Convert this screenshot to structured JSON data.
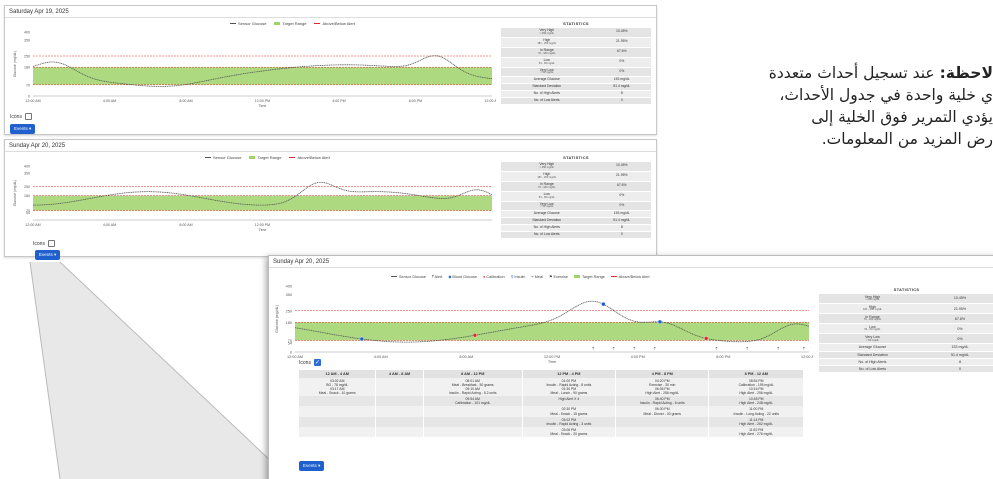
{
  "callout": {
    "lines": [
      "لاحظة: عند تسجيل أحداث متعددة",
      "ي خلية واحدة في جدول الأحداث،",
      "يؤدي التمرير فوق الخلية إلى",
      "رض المزيد من المعلومات."
    ],
    "bold_prefix": "لاحظة:"
  },
  "colors": {
    "target_band": "#9fd36a",
    "alert_line": "#e0282d",
    "glucose_line": "#555555",
    "button": "#1f5fce"
  },
  "panels": [
    {
      "date": "Saturday Apr 19, 2025",
      "legend": {
        "sensor": "Sensor Glucose",
        "target": "Target Range",
        "alert": "Above/Below Alert",
        "alert_sub": "CGM User Settings"
      },
      "y_axis_label": "Glucose (mg/dL)",
      "y_ticks": [
        "400",
        "350",
        "250",
        "180",
        "70",
        "0"
      ],
      "x_ticks": [
        "12:00 AM",
        "4:00 AM",
        "8:00 AM",
        "12:00 PM",
        "4:00 PM",
        "8:00 PM",
        "12:00 AM"
      ],
      "x_axis_label": "Time",
      "icons_label": "Icons",
      "events_label": "Events ▾"
    },
    {
      "date": "Sunday Apr 20, 2025",
      "legend": {
        "sensor": "Sensor Glucose",
        "target": "Target Range",
        "alert": "Above/Below Alert",
        "alert_sub": "CGM User Settings"
      },
      "y_axis_label": "Glucose (mg/dL)",
      "y_ticks": [
        "400",
        "350",
        "250",
        "180",
        "70",
        "54"
      ],
      "x_ticks": [
        "12:00 AM",
        "4:00 AM",
        "8:00 AM",
        "12:00 PM"
      ],
      "x_axis_label": "Time",
      "icons_label": "Icons",
      "events_label": "Events ▾"
    }
  ],
  "stats": {
    "title": "STATISTICS",
    "rows": [
      {
        "label": "Very High",
        "sub": "> 250 mg/dL",
        "value": "10.45%"
      },
      {
        "label": "High",
        "sub": "181 - 250 mg/dL",
        "value": "21.95%"
      },
      {
        "label": "In Range",
        "sub": "70 - 180 mg/dL",
        "value": "67.6%"
      },
      {
        "label": "Low",
        "sub": "54 - 69 mg/dL",
        "value": "0%"
      },
      {
        "label": "Very Low",
        "sub": "< 54 mg/dL",
        "value": "0%"
      },
      {
        "label": "Average Glucose",
        "sub": "",
        "value": "153 mg/dL"
      },
      {
        "label": "Standard Deviation",
        "sub": "",
        "value": "51.4 mg/dL"
      },
      {
        "label": "No. of High Alerts",
        "sub": "",
        "value": "8"
      },
      {
        "label": "No. of Low Alerts",
        "sub": "",
        "value": "0"
      }
    ]
  },
  "zoom": {
    "date": "Sunday Apr 20, 2025",
    "legend": {
      "sensor": "Sensor Glucose",
      "alert": "Alert",
      "blood": "Blood Glucose",
      "calibration": "Calibration",
      "insulin": "Insulin",
      "meal": "Meal",
      "exercise": "Exercise",
      "target": "Target Range",
      "abovebelow": "Above/Below Alert",
      "abovebelow_sub": "CGM User Settings"
    },
    "y_axis_label": "Glucose (mg/dL)",
    "y_ticks": [
      "400",
      "350",
      "250",
      "180",
      "70",
      "54",
      "0"
    ],
    "x_ticks": [
      "12:00 AM",
      "4:00 AM",
      "8:00 AM",
      "12:00 PM",
      "4:00 PM",
      "8:00 PM",
      "12:00 AM"
    ],
    "x_axis_label": "Time",
    "icons_label": "Icons",
    "events_label": "Events ▾",
    "table": {
      "headers": [
        "12 AM - 4 AM",
        "4 AM - 8 AM",
        "8 AM - 12 PM",
        "12 PM - 4 PM",
        "4 PM - 8 PM",
        "8 PM - 12 AM"
      ],
      "rows": [
        [
          [
            "03:02 AM",
            "BG - 78 mg/dL",
            "03:17 AM",
            "Meal - Snack - 10 grams"
          ],
          [],
          [
            "08:01 AM",
            "Meal - Breakfast - 50 grams",
            "09:10 AM",
            "Insulin - Rapid Acting - 5.2 units"
          ],
          [
            "01:00 PM",
            "Insulin - Rapid Acting - 8 units",
            "01:30 PM",
            "Meal - Lunch - 90 grams"
          ],
          [
            "04:20 PM",
            "Exercise - 30 min",
            "06:36 PM",
            "High Alert - 256 mg/dL"
          ],
          [
            "08:54 PM",
            "Calibration - 195 mg/dL",
            "10:16 PM",
            "High Alert - 256 mg/dL"
          ]
        ],
        [
          [],
          [],
          [
            "09:54 AM",
            "Calibration - 101 mg/dL"
          ],
          [
            "High Alert X 4"
          ],
          [
            "06:40 PM",
            "Insulin - Rapid Acting - 6 units"
          ],
          [
            "10:48 PM",
            "High Alert - 248 mg/dL"
          ]
        ],
        [
          [],
          [],
          [],
          [
            "02:30 PM",
            "Meal - Snack - 15 grams"
          ],
          [
            "06:30 PM",
            "Meal - Dinner - 30 grams"
          ],
          [
            "11:00 PM",
            "Insulin - Long Acting - 22 units"
          ]
        ],
        [
          [],
          [],
          [],
          [
            "03:02 PM",
            "Insulin - Rapid Acting - 3 units"
          ],
          [],
          [
            "11:14 PM",
            "High Alert - 262 mg/dL"
          ]
        ],
        [
          [],
          [],
          [],
          [
            "03:06 PM",
            "Meal - Snack - 20 grams"
          ],
          [],
          [
            "11:52 PM",
            "High Alert - 276 mg/dL"
          ]
        ]
      ]
    }
  }
}
